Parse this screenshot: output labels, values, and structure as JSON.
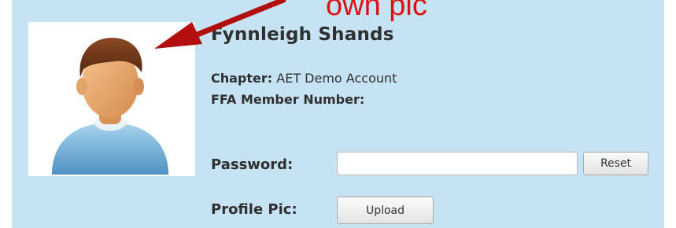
{
  "profile": {
    "name": "Fynnleigh Shands",
    "chapter_label": "Chapter:",
    "chapter_value": "AET Demo Account",
    "ffa_label": "FFA Member Number:",
    "ffa_value": "",
    "password_label": "Password:",
    "password_value": "",
    "password_placeholder": "",
    "reset_label": "Reset",
    "profile_pic_label": "Profile Pic:",
    "upload_label": "Upload",
    "avatar_icon": "default-user-avatar"
  },
  "annotation": {
    "text": "own pic",
    "color": "#dd1111"
  },
  "colors": {
    "panel_background": "#c6e3f3",
    "text": "#2f2f2f"
  }
}
